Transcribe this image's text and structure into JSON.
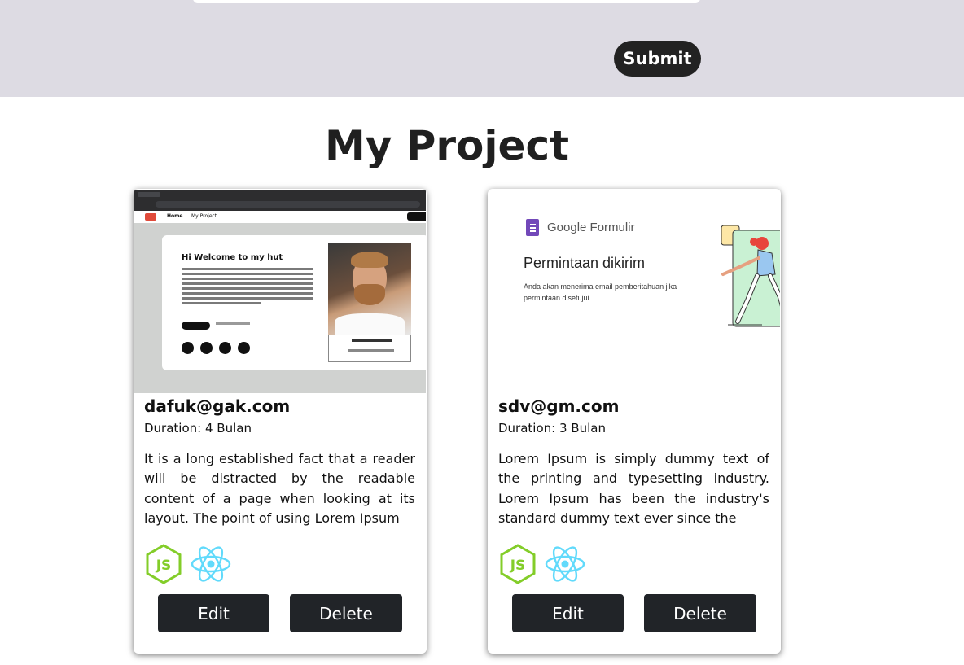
{
  "form": {
    "submit_label": "Submit"
  },
  "section": {
    "title": "My Project"
  },
  "projects": [
    {
      "email": "dafuk@gak.com",
      "duration": "Duration: 4 Bulan",
      "description": "It is a long established fact that a reader will be distracted by the readable content of a page when looking at its layout. The point of using Lorem Ipsum",
      "thumbnail": {
        "nav_home": "Home",
        "nav_project": "My Project",
        "heading": "Hi Welcome to my hut"
      },
      "tech_icons": [
        "nodejs-icon",
        "react-icon"
      ],
      "edit_label": "Edit",
      "delete_label": "Delete"
    },
    {
      "email": "sdv@gm.com",
      "duration": "Duration: 3 Bulan",
      "description": "Lorem Ipsum is simply dummy text of the printing and typesetting industry. Lorem Ipsum has been the industry's standard dummy text ever since the",
      "thumbnail": {
        "brand": "Google Formulir",
        "heading": "Permintaan dikirim",
        "subtext": "Anda akan menerima email pemberitahuan jika permintaan disetujui"
      },
      "tech_icons": [
        "nodejs-icon",
        "react-icon"
      ],
      "edit_label": "Edit",
      "delete_label": "Delete"
    }
  ],
  "colors": {
    "header_band": "#dddbe3",
    "button_dark": "#212428",
    "node_green": "#83cd29",
    "react_blue": "#61dafb"
  }
}
